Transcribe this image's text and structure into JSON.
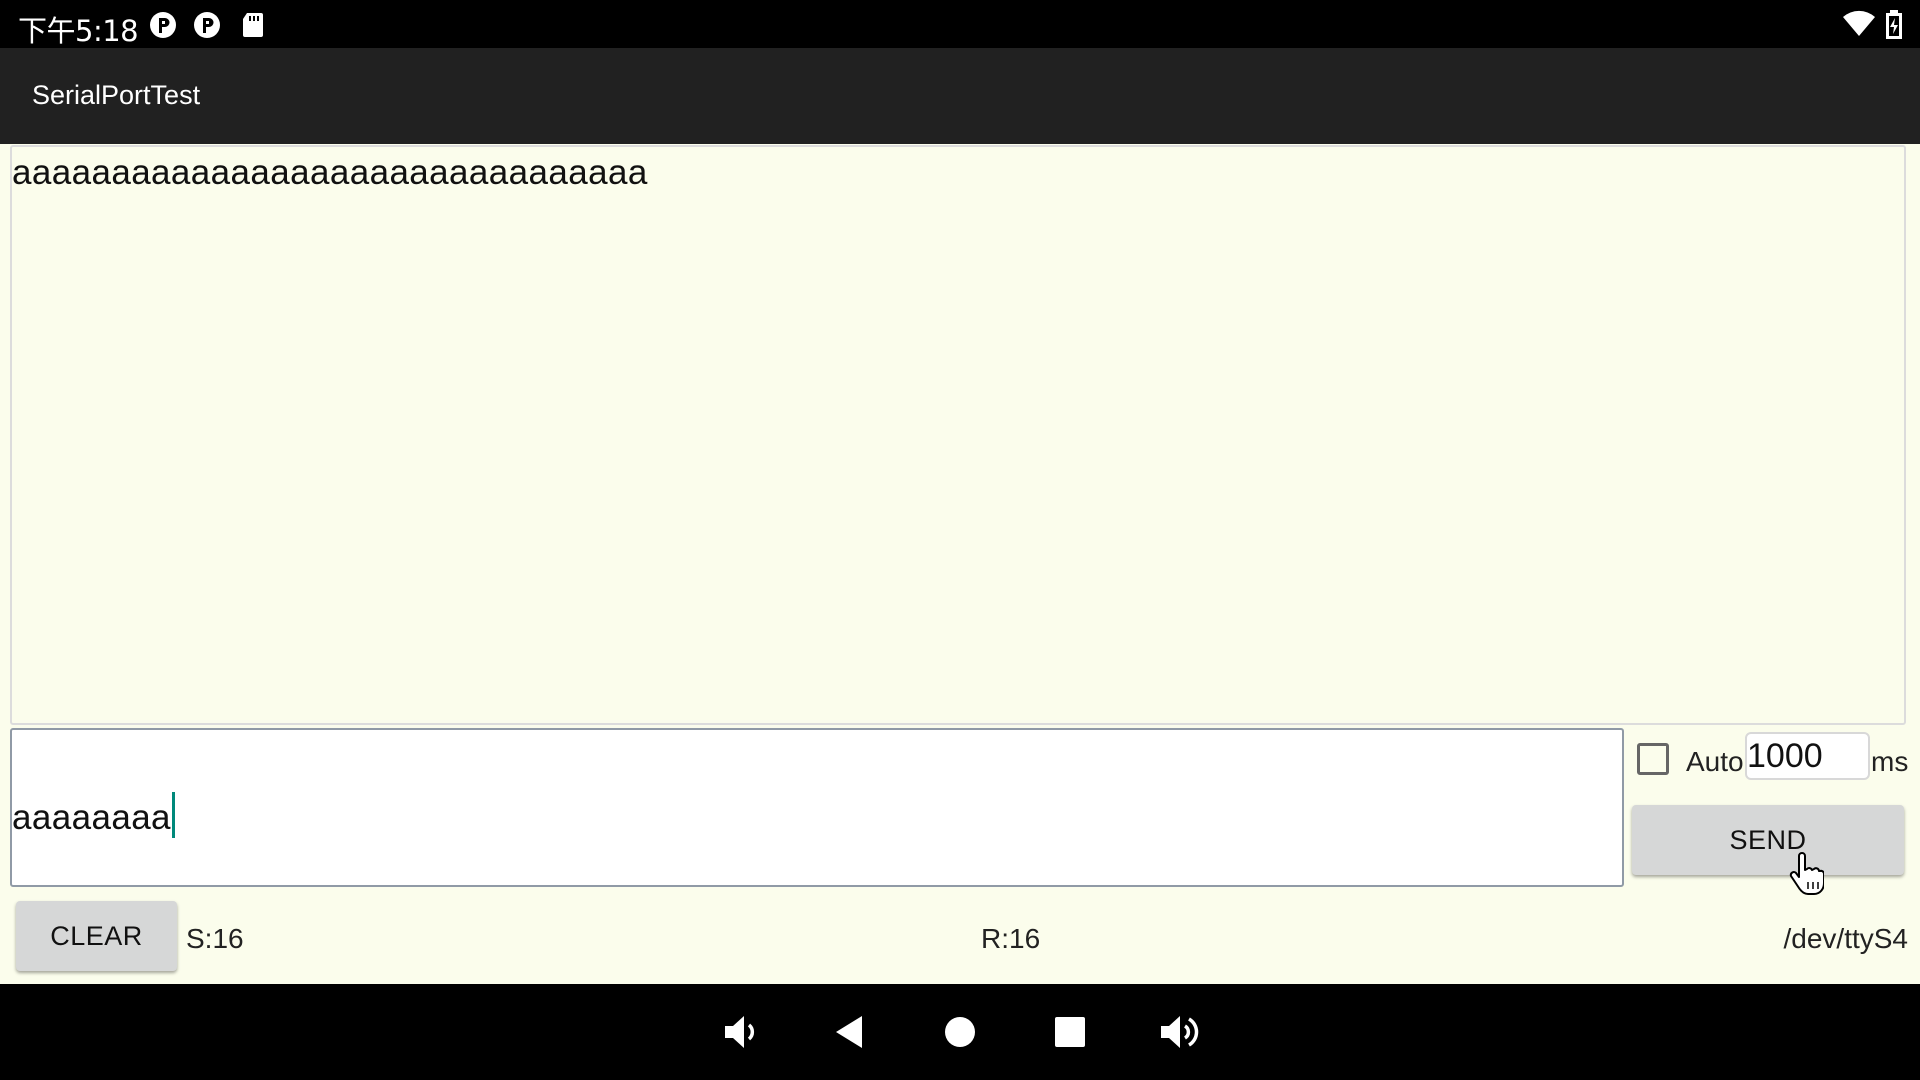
{
  "status_bar": {
    "time": "下午5:18",
    "icons_left": [
      "p-icon",
      "p-icon",
      "sd-card-icon"
    ],
    "icons_right": [
      "wifi-icon",
      "battery-charging-icon"
    ]
  },
  "app": {
    "title": "SerialPortTest"
  },
  "receive": {
    "text": "aaaaaaaaaaaaaaaaaaaaaaaaaaaaaaaa"
  },
  "send_input": {
    "value": "aaaaaaaa"
  },
  "auto": {
    "label": "Auto",
    "checked": false,
    "interval_value": "1000",
    "unit": "ms"
  },
  "buttons": {
    "send": "SEND",
    "clear": "CLEAR"
  },
  "counters": {
    "sent": "S:16",
    "received": "R:16",
    "port": "/dev/ttyS4"
  },
  "nav_bar": {
    "icons": [
      "volume-down-icon",
      "back-icon",
      "home-icon",
      "recents-icon",
      "volume-up-icon"
    ]
  },
  "colors": {
    "background": "#fbfdec",
    "app_bar": "#212121",
    "button": "#d6d7d7",
    "caret": "#00897b"
  }
}
